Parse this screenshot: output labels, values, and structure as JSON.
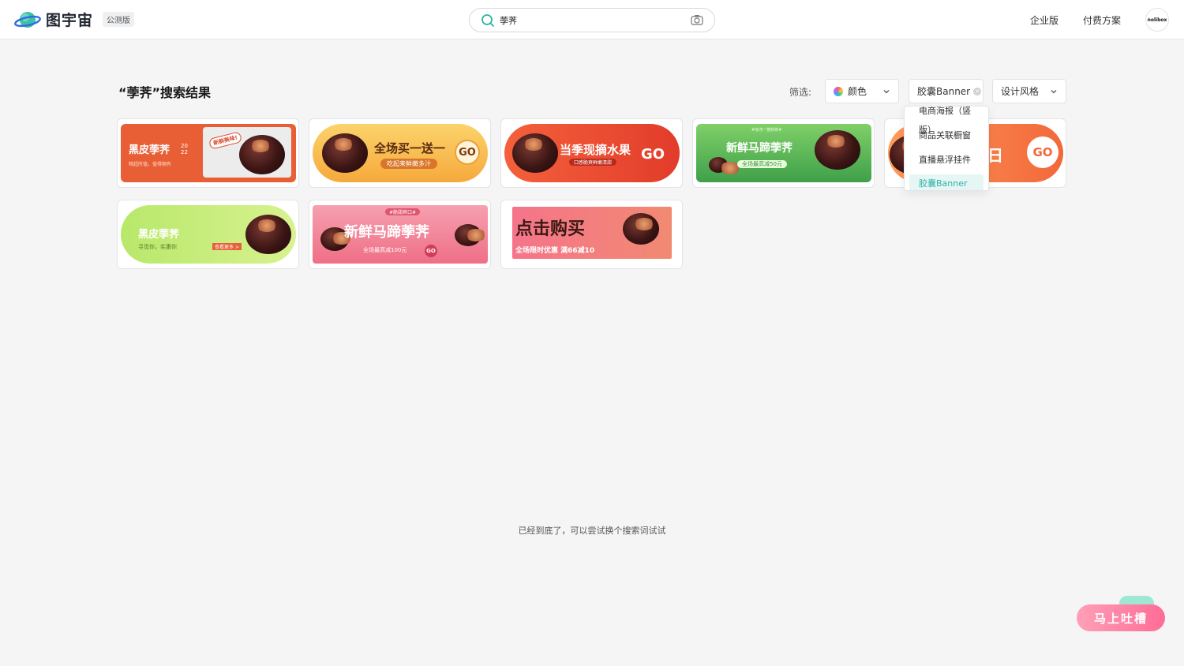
{
  "header": {
    "logo_text": "图宇宙",
    "beta_badge": "公测版",
    "search_value": "荸荠",
    "links": {
      "enterprise": "企业版",
      "pricing": "付费方案"
    },
    "avatar_text": "nolibox"
  },
  "toolbar": {
    "results_title": "“荸荠”搜索结果",
    "filter_label": "筛选:",
    "filters": {
      "color": "颜色",
      "type": "胶囊Banner",
      "style": "设计风格"
    }
  },
  "dropdown": {
    "items": [
      "电商海报（竖版）",
      "商品关联橱窗",
      "直播悬浮挂件",
      "胶囊Banner"
    ]
  },
  "results": [
    {
      "title": "黑皮荸荠",
      "sub": "物超所值，值得拥有",
      "tag": "新鲜美味!",
      "year": "20 22"
    },
    {
      "title": "全场买一送一",
      "sub": "吃起来鲜嫩多汁",
      "go": "GO"
    },
    {
      "title": "当季现摘水果",
      "sub": "口感脆爽鲜嫩清甜",
      "go": "GO"
    },
    {
      "title": "新鲜马蹄荸荠",
      "tag": "#惊鸿一瞥新鲜#",
      "sub": "全场最高减50元"
    },
    {
      "title": "日",
      "go": "GO"
    },
    {
      "title": "黑皮荸荠",
      "sub": "寻觅你，实惠你",
      "cta": "查看更多 >"
    },
    {
      "title": "新鲜马蹄荸荠",
      "tag": "#脆甜爽口#",
      "sub": "全场最高减100元",
      "go": "GO"
    },
    {
      "title": "点击购买",
      "sub": "全场限时优惠 满66减10"
    }
  ],
  "end_note": "已经到底了，可以尝试换个搜索词试试",
  "feedback": "马上吐槽",
  "colors": {
    "accent": "#2bb3a6",
    "orange": "#f06a3a",
    "green": "#4caf50",
    "pink": "#f07a8e"
  }
}
